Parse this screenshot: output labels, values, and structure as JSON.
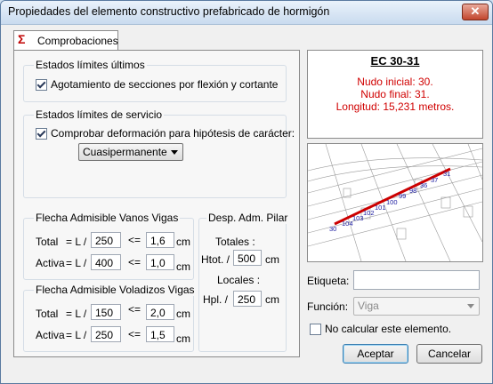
{
  "window": {
    "title": "Propiedades del elemento constructivo prefabricado de hormigón",
    "close_label": "✕"
  },
  "tab": {
    "icon": "Σ",
    "label": "Comprobaciones"
  },
  "ultimate": {
    "title": "Estados límites últimos",
    "check_label": "Agotamiento de secciones por flexión y cortante",
    "checked": true
  },
  "service": {
    "title": "Estados límites de servicio",
    "check_label": "Comprobar deformación para hipótesis de carácter:",
    "checked": true,
    "select_value": "Cuasipermanente"
  },
  "vanos": {
    "title": "Flecha Admisible Vanos Vigas",
    "total_label": "Total",
    "eq1": "= L /",
    "total_value": "250",
    "le": "<=",
    "total_limit": "1,6",
    "unit": "cm",
    "active_label": "Activa",
    "eq2": "= L /",
    "active_value": "400",
    "active_limit": "1,0"
  },
  "voladizos": {
    "title": "Flecha Admisible Voladizos Vigas",
    "total_label": "Total",
    "eq1": "= L /",
    "total_value": "150",
    "le": "<=",
    "total_limit": "2,0",
    "unit": "cm",
    "active_label": "Activa",
    "eq2": "= L /",
    "active_value": "250",
    "active_limit": "1,5"
  },
  "pilar": {
    "title": "Desp. Adm. Pilar",
    "totales_label": "Totales :",
    "htot_label": "Htot. /",
    "htot_value": "500",
    "locales_label": "Locales :",
    "hpl_label": "Hpl. /",
    "hpl_value": "250",
    "unit": "cm"
  },
  "element": {
    "name": "EC 30-31",
    "start_node": "Nudo inicial: 30.",
    "end_node": "Nudo final: 31.",
    "length": "Longitud: 15,231 metros."
  },
  "view_labels": [
    "30",
    "104",
    "103",
    "102",
    "101",
    "100",
    "99",
    "98",
    "36",
    "37",
    "31"
  ],
  "form": {
    "label_label": "Etiqueta:",
    "label_value": "",
    "function_label": "Función:",
    "function_value": "Viga",
    "no_calc_label": "No calcular este elemento.",
    "no_calc_checked": false
  },
  "buttons": {
    "accept": "Aceptar",
    "cancel": "Cancelar"
  }
}
